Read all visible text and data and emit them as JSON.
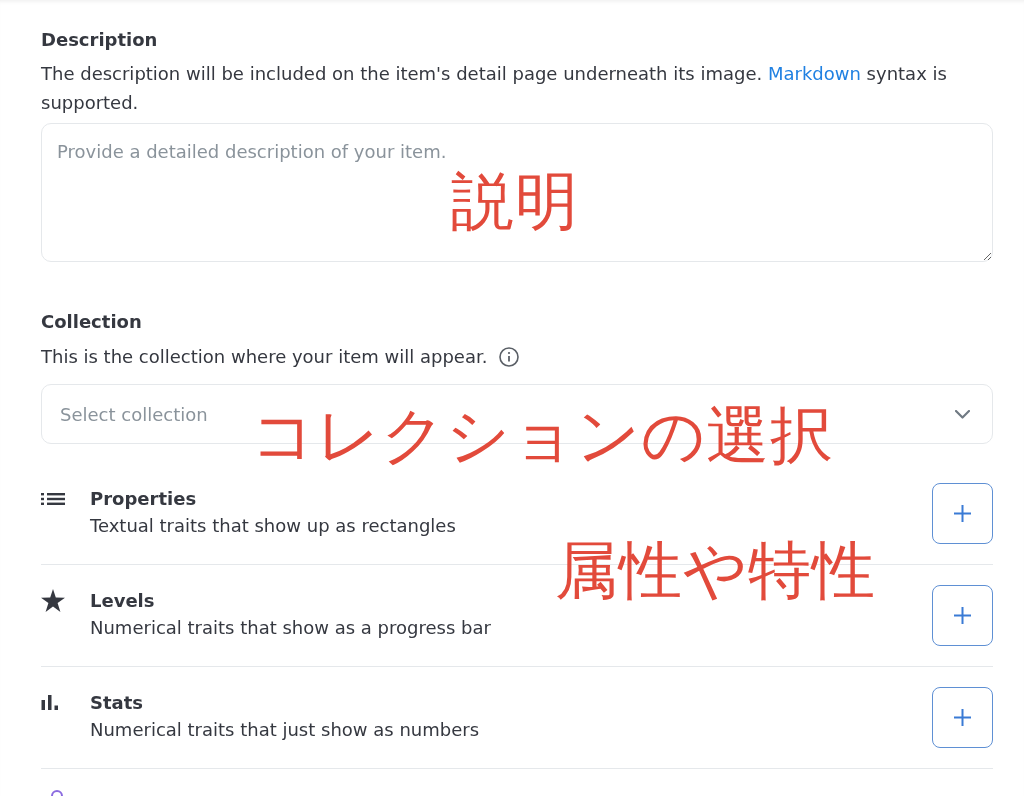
{
  "description": {
    "heading": "Description",
    "help_before": "The description will be included on the item's detail page underneath its image.",
    "help_link": "Markdown",
    "help_after": "syntax is supported.",
    "placeholder": "Provide a detailed description of your item.",
    "annotation": "説明"
  },
  "collection": {
    "heading": "Collection",
    "help": "This is the collection where your item will appear.",
    "placeholder": "Select collection",
    "annotation": "コレクションの選択"
  },
  "traits": {
    "annotation": "属性や特性",
    "items": [
      {
        "kind": "properties",
        "title": "Properties",
        "subtitle": "Textual traits that show up as rectangles"
      },
      {
        "kind": "levels",
        "title": "Levels",
        "subtitle": "Numerical traits that show as a progress bar"
      },
      {
        "kind": "stats",
        "title": "Stats",
        "subtitle": "Numerical traits that just show as numbers"
      }
    ]
  }
}
